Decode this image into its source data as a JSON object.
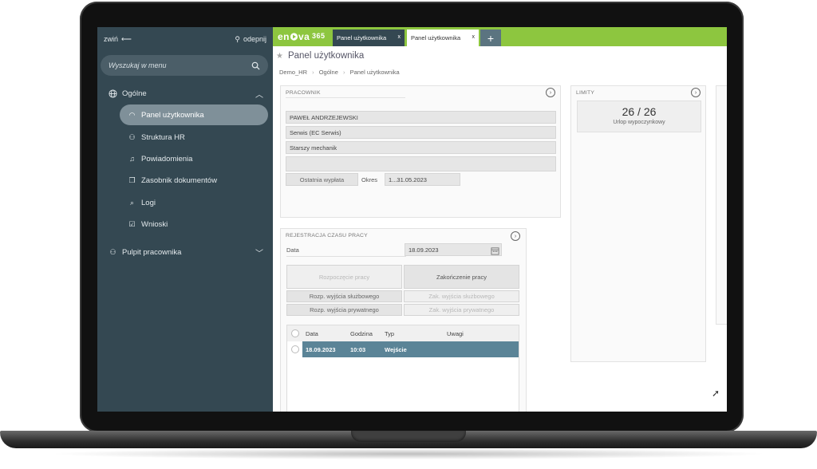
{
  "sidebar": {
    "collapse_label": "zwiń",
    "unpin_label": "odepnij",
    "search_placeholder": "Wyszukaj w menu",
    "sections": [
      {
        "label": "Ogólne"
      },
      {
        "label": "Pulpit pracownika"
      }
    ],
    "items": [
      {
        "label": "Panel użytkownika"
      },
      {
        "label": "Struktura HR"
      },
      {
        "label": "Powiadomienia"
      },
      {
        "label": "Zasobnik dokumentów"
      },
      {
        "label": "Logi"
      },
      {
        "label": "Wnioski"
      }
    ]
  },
  "header": {
    "tabs": [
      {
        "label": "Panel użytkownika"
      },
      {
        "label": "Panel użytkownika"
      }
    ],
    "close_glyph": "x",
    "add_glyph": "+"
  },
  "main": {
    "title": "Panel użytkownika",
    "breadcrumb": [
      "Demo_HR",
      "Ogólne",
      "Panel użytkownika"
    ],
    "employee": {
      "title": "PRACOWNIK",
      "name": "PAWEŁ ANDRZEJEWSKI",
      "department": "Serwis (EC Serwis)",
      "position": "Starszy mechanik",
      "extra": "",
      "last_payout_label": "Ostatnia wypłata",
      "period_label": "Okres",
      "period_value": "1...31.05.2023"
    },
    "limits": {
      "title": "LIMITY",
      "value": "26 / 26",
      "label": "Urlop wypoczynkowy"
    },
    "worktime": {
      "title": "REJESTRACJA CZASU PRACY",
      "date_label": "Data",
      "date_value": "18.09.2023",
      "start_work": "Rozpoczęcie pracy",
      "end_work": "Zakończenie pracy",
      "start_business": "Rozp. wyjścia służbowego",
      "end_business": "Zak. wyjścia służbowego",
      "start_private": "Rozp. wyjścia prywatnego",
      "end_private": "Zak. wyjścia prywatnego",
      "columns": [
        "Data",
        "Godzina",
        "Typ",
        "Uwagi"
      ],
      "rows": [
        {
          "date": "18.09.2023",
          "time": "10:03",
          "type": "Wejście",
          "notes": ""
        }
      ]
    }
  },
  "colors": {
    "sidebar": "#344852",
    "accent": "#8dc63f",
    "selected_row": "#5b8497"
  }
}
